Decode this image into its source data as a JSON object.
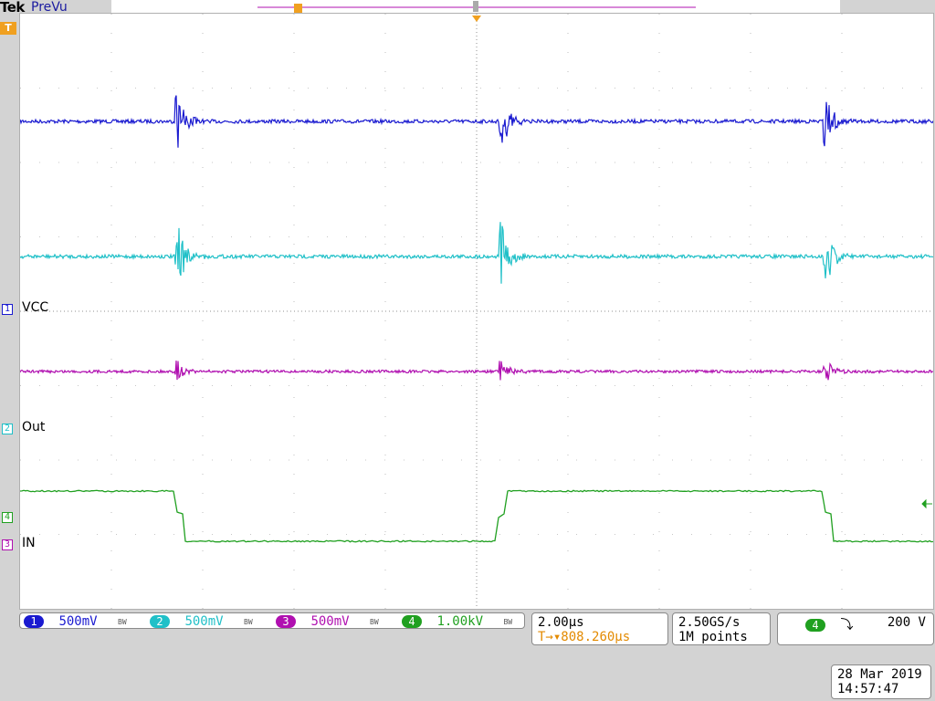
{
  "header": {
    "brand": "Tek",
    "mode": "PreVu"
  },
  "trigger_marker": "T",
  "channels": [
    {
      "num": "1",
      "name": "VCC",
      "color": "#1a1ad0",
      "scale": "500mV",
      "bw": "BW"
    },
    {
      "num": "2",
      "name": "Out",
      "color": "#20c0c8",
      "scale": "500mV",
      "bw": "BW"
    },
    {
      "num": "3",
      "name": "IN",
      "color": "#b010b0",
      "scale": "500mV",
      "bw": "BW"
    },
    {
      "num": "4",
      "name": "",
      "color": "#20a020",
      "scale": "1.00kV",
      "bw": "BW"
    }
  ],
  "timebase": {
    "scale": "2.00µs",
    "delay": "808.260µs",
    "delay_prefix": "T→▾"
  },
  "acquisition": {
    "rate": "2.50GS/s",
    "record": "1M points"
  },
  "trigger": {
    "channel": "4",
    "slope": "⤵",
    "level": "200 V"
  },
  "datetime": {
    "date": "28 Mar 2019",
    "time": "14:57:47"
  },
  "colors": {
    "grid": "#909090",
    "trigger_orange": "#f0a020"
  }
}
